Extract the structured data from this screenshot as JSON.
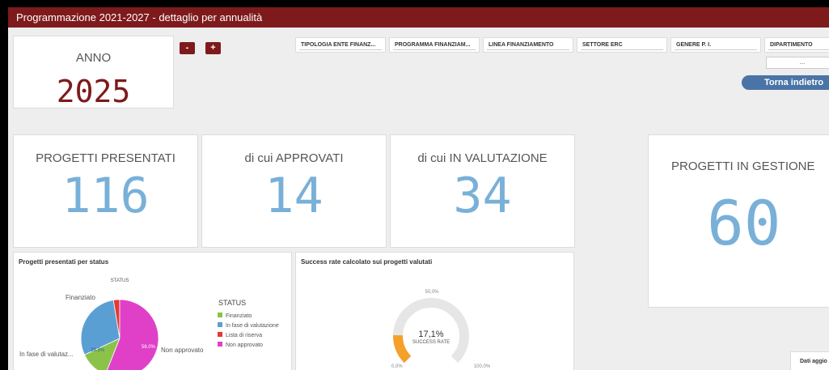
{
  "header": {
    "title": "Programmazione 2021-2027 - dettaglio per annualità"
  },
  "anno": {
    "label": "ANNO",
    "value": "2025",
    "minus_label": "-",
    "plus_label": "+"
  },
  "filters": [
    {
      "label": "TIPOLOGIA ENTE FINANZ..."
    },
    {
      "label": "PROGRAMMA FINANZIAM..."
    },
    {
      "label": "LINEA FINANZIAMENTO"
    },
    {
      "label": "SETTORE ERC"
    },
    {
      "label": "GENERE P. I."
    },
    {
      "label": "DIPARTIMENTO"
    }
  ],
  "dipartimento_value": "...",
  "back_button": {
    "label": "Torna indietro"
  },
  "kpis": [
    {
      "label": "PROGETTI PRESENTATI",
      "value": "116"
    },
    {
      "label": "di cui APPROVATI",
      "value": "14"
    },
    {
      "label": "di cui IN VALUTAZIONE",
      "value": "34"
    },
    {
      "label": "PROGETTI IN GESTIONE",
      "value": "60"
    }
  ],
  "status_panel": {
    "title": "Progetti presentati per status",
    "dimension_label": "STATUS",
    "legend_title": "STATUS",
    "slice_labels": {
      "finanziato": "Finanziato",
      "in_valutazione": "In fase di valutaz...",
      "non_approvato": "Non approvato"
    },
    "slice_pct": {
      "in_valutazione": "29.3%",
      "non_approvato": "56.0%"
    }
  },
  "success_panel": {
    "title": "Success rate calcolato sui progetti valutati",
    "value_label": "17,1%",
    "caption": "SUCCESS RATE",
    "tick_min": "0,0%",
    "tick_mid": "50,0%",
    "tick_max": "100,0%"
  },
  "footer_note": "Dati aggio",
  "colors": {
    "brand": "#7e1a1c",
    "kpi_value": "#79b0d8",
    "finanziato": "#8bc34a",
    "in_valutazione": "#5a9fd4",
    "lista_riserva": "#e53935",
    "non_approvato": "#e040c8",
    "gauge": "#f5a02a",
    "gauge_track": "#e6e6e6"
  },
  "chart_data": [
    {
      "type": "pie",
      "title": "Progetti presentati per status",
      "legend_title": "STATUS",
      "categories": [
        "Finanziato",
        "In fase di valutazione",
        "Lista di riserva",
        "Non approvato"
      ],
      "values": [
        12.1,
        29.3,
        2.6,
        56.0
      ],
      "unit": "%"
    },
    {
      "type": "gauge",
      "title": "Success rate calcolato sui progetti valutati",
      "value": 17.1,
      "range": [
        0,
        100
      ],
      "unit": "%"
    }
  ]
}
